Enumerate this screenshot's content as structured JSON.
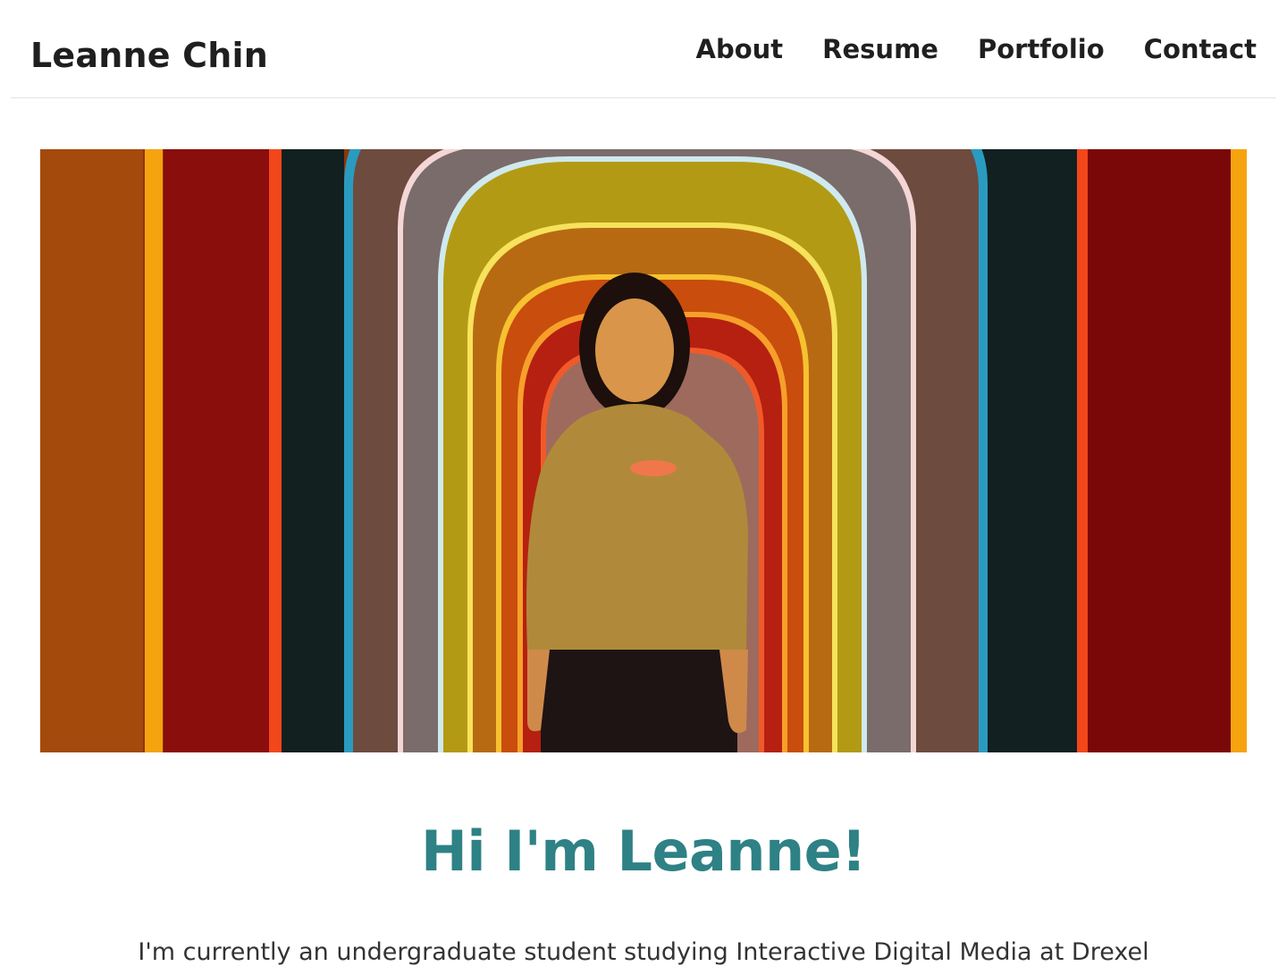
{
  "header": {
    "brand": "Leanne Chin",
    "nav": [
      {
        "label": "About"
      },
      {
        "label": "Resume"
      },
      {
        "label": "Portfolio"
      },
      {
        "label": "Contact"
      }
    ]
  },
  "hero": {
    "image_description_icon": "photo-of-person-in-rainbow-arch-tunnel"
  },
  "main": {
    "headline": "Hi I'm Leanne!",
    "intro": "I'm currently an undergraduate student studying Interactive Digital Media at Drexel"
  },
  "colors": {
    "accent": "#2e8185",
    "text": "#1f1f1f",
    "divider": "#e2e2e2"
  }
}
